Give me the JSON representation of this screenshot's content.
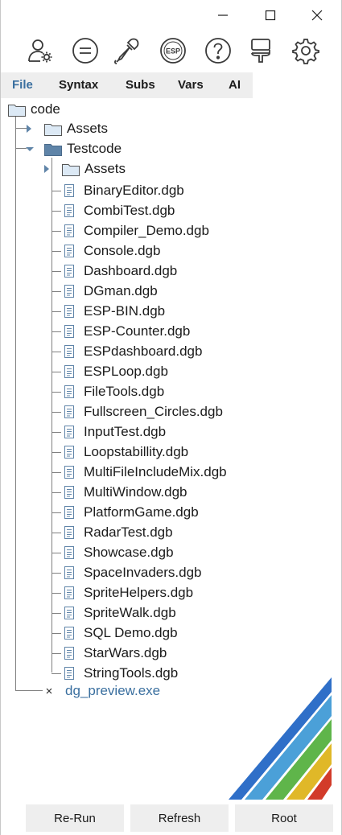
{
  "window": {
    "minimize_icon": "minimize-icon",
    "maximize_icon": "maximize-icon",
    "close_icon": "close-icon"
  },
  "toolbar": {
    "icons": [
      "user-settings-icon",
      "equals-icon",
      "eyedropper-icon",
      "esp-icon",
      "help-icon",
      "brush-icon",
      "gear-icon"
    ],
    "esp_text": "ESP"
  },
  "tabs": [
    "File",
    "Syntax",
    "Subs",
    "Vars",
    "AI"
  ],
  "active_tab": "File",
  "tree": {
    "root": "code",
    "assets_folder": "Assets",
    "testcode_folder": "Testcode",
    "testcode_assets": "Assets",
    "files": [
      "BinaryEditor.dgb",
      "CombiTest.dgb",
      "Compiler_Demo.dgb",
      "Console.dgb",
      "Dashboard.dgb",
      "DGman.dgb",
      "ESP-BIN.dgb",
      "ESP-Counter.dgb",
      "ESPdashboard.dgb",
      "ESPLoop.dgb",
      "FileTools.dgb",
      "Fullscreen_Circles.dgb",
      "InputTest.dgb",
      "Loopstabillity.dgb",
      "MultiFileIncludeMix.dgb",
      "MultiWindow.dgb",
      "PlatformGame.dgb",
      "RadarTest.dgb",
      "Showcase.dgb",
      "SpaceInvaders.dgb",
      "SpriteHelpers.dgb",
      "SpriteWalk.dgb",
      "SQL Demo.dgb",
      "StarWars.dgb",
      "StringTools.dgb"
    ],
    "exe": "dg_preview.exe"
  },
  "buttons": {
    "rerun": "Re-Run",
    "refresh": "Refresh",
    "root": "Root"
  },
  "colors": {
    "accent": "#3a6f9f",
    "folder_closed": "#dce9f5",
    "folder_open": "#5f84a8",
    "stripes": [
      "#2f6fc8",
      "#4ba0d8",
      "#5fb54a",
      "#e0b828",
      "#d23b2a"
    ]
  }
}
